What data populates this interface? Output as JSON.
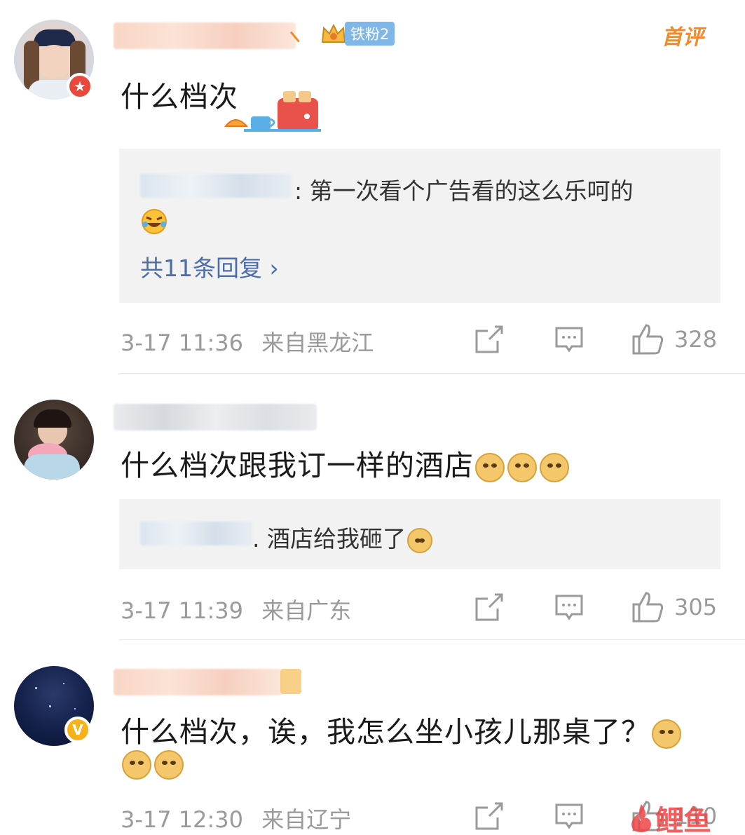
{
  "comments": [
    {
      "fan_badge": "铁粉2",
      "first_comment_tag": "首评",
      "body": "什么档次",
      "reply": {
        "text": ": 第一次看个广告看的这么乐呵的",
        "more": "共11条回复 ›"
      },
      "time": "3-17 11:36",
      "location": "来自黑龙江",
      "likes": "328"
    },
    {
      "body": "什么档次跟我订一样的酒店",
      "reply": {
        "text": ". 酒店给我砸了"
      },
      "time": "3-17 11:39",
      "location": "来自广东",
      "likes": "305"
    },
    {
      "body_line1": "什么档次，诶，我怎么坐小孩儿那桌了？",
      "time": "3-17 12:30",
      "location": "来自辽宁",
      "likes": "110"
    }
  ],
  "watermark": "鲤鱼",
  "icons": {
    "repost": "repost-icon",
    "comment": "comment-icon",
    "like": "like-icon"
  },
  "colors": {
    "link": "#4b6ea8",
    "meta": "#9a9a9a",
    "reply_bg": "#f2f2f2",
    "first_comment": "#f08a2a"
  }
}
